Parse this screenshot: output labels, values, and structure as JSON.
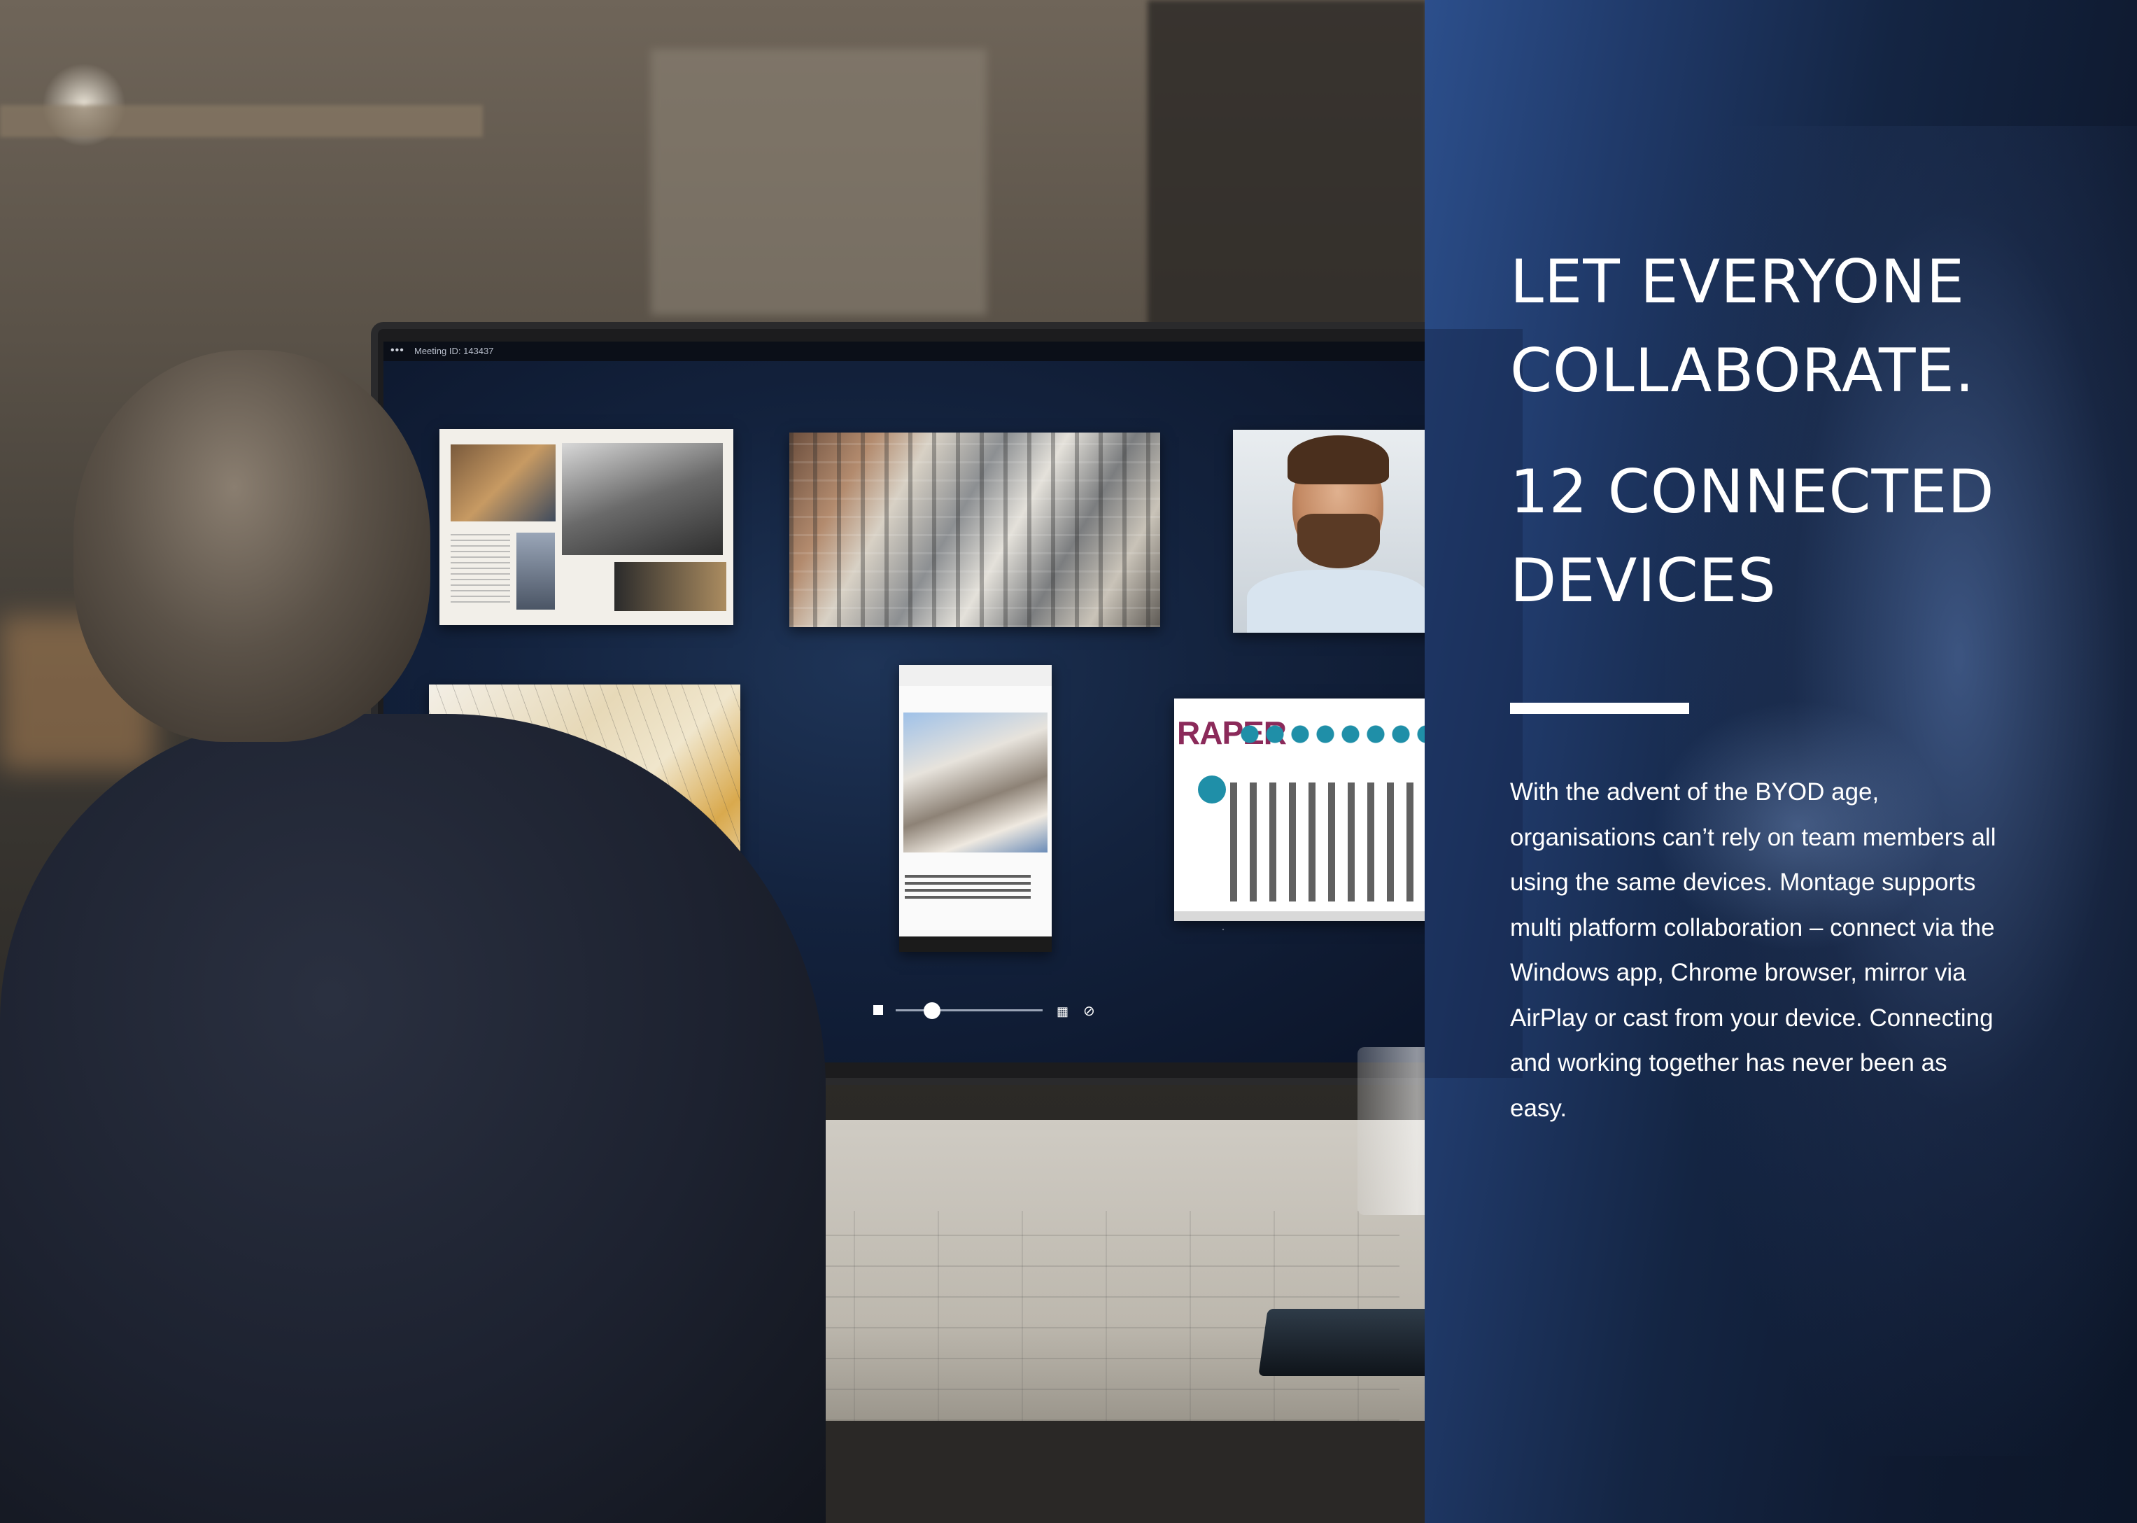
{
  "screen": {
    "meeting_id": "Meeting ID: 143437",
    "menu_glyph": "•••",
    "tiles": {
      "chart_title": "RAPER"
    },
    "controls": {
      "grid_glyph": "▦",
      "mute_glyph": "⊘"
    }
  },
  "panel": {
    "headline_1": "LET EVERYONE\nCOLLABORATE.",
    "headline_2": "12 CONNECTED\nDEVICES",
    "body": "With the advent of the BYOD age, organisations can’t rely on team members all using the same devices. Montage supports multi platform collaboration – connect via the Windows app, Chrome browser, mirror via AirPlay or cast from your device. Connecting and working together has never been as easy."
  },
  "colors": {
    "panel_blue": "#142543",
    "accent_teal": "#1f8fa8",
    "text_white": "#ffffff"
  }
}
